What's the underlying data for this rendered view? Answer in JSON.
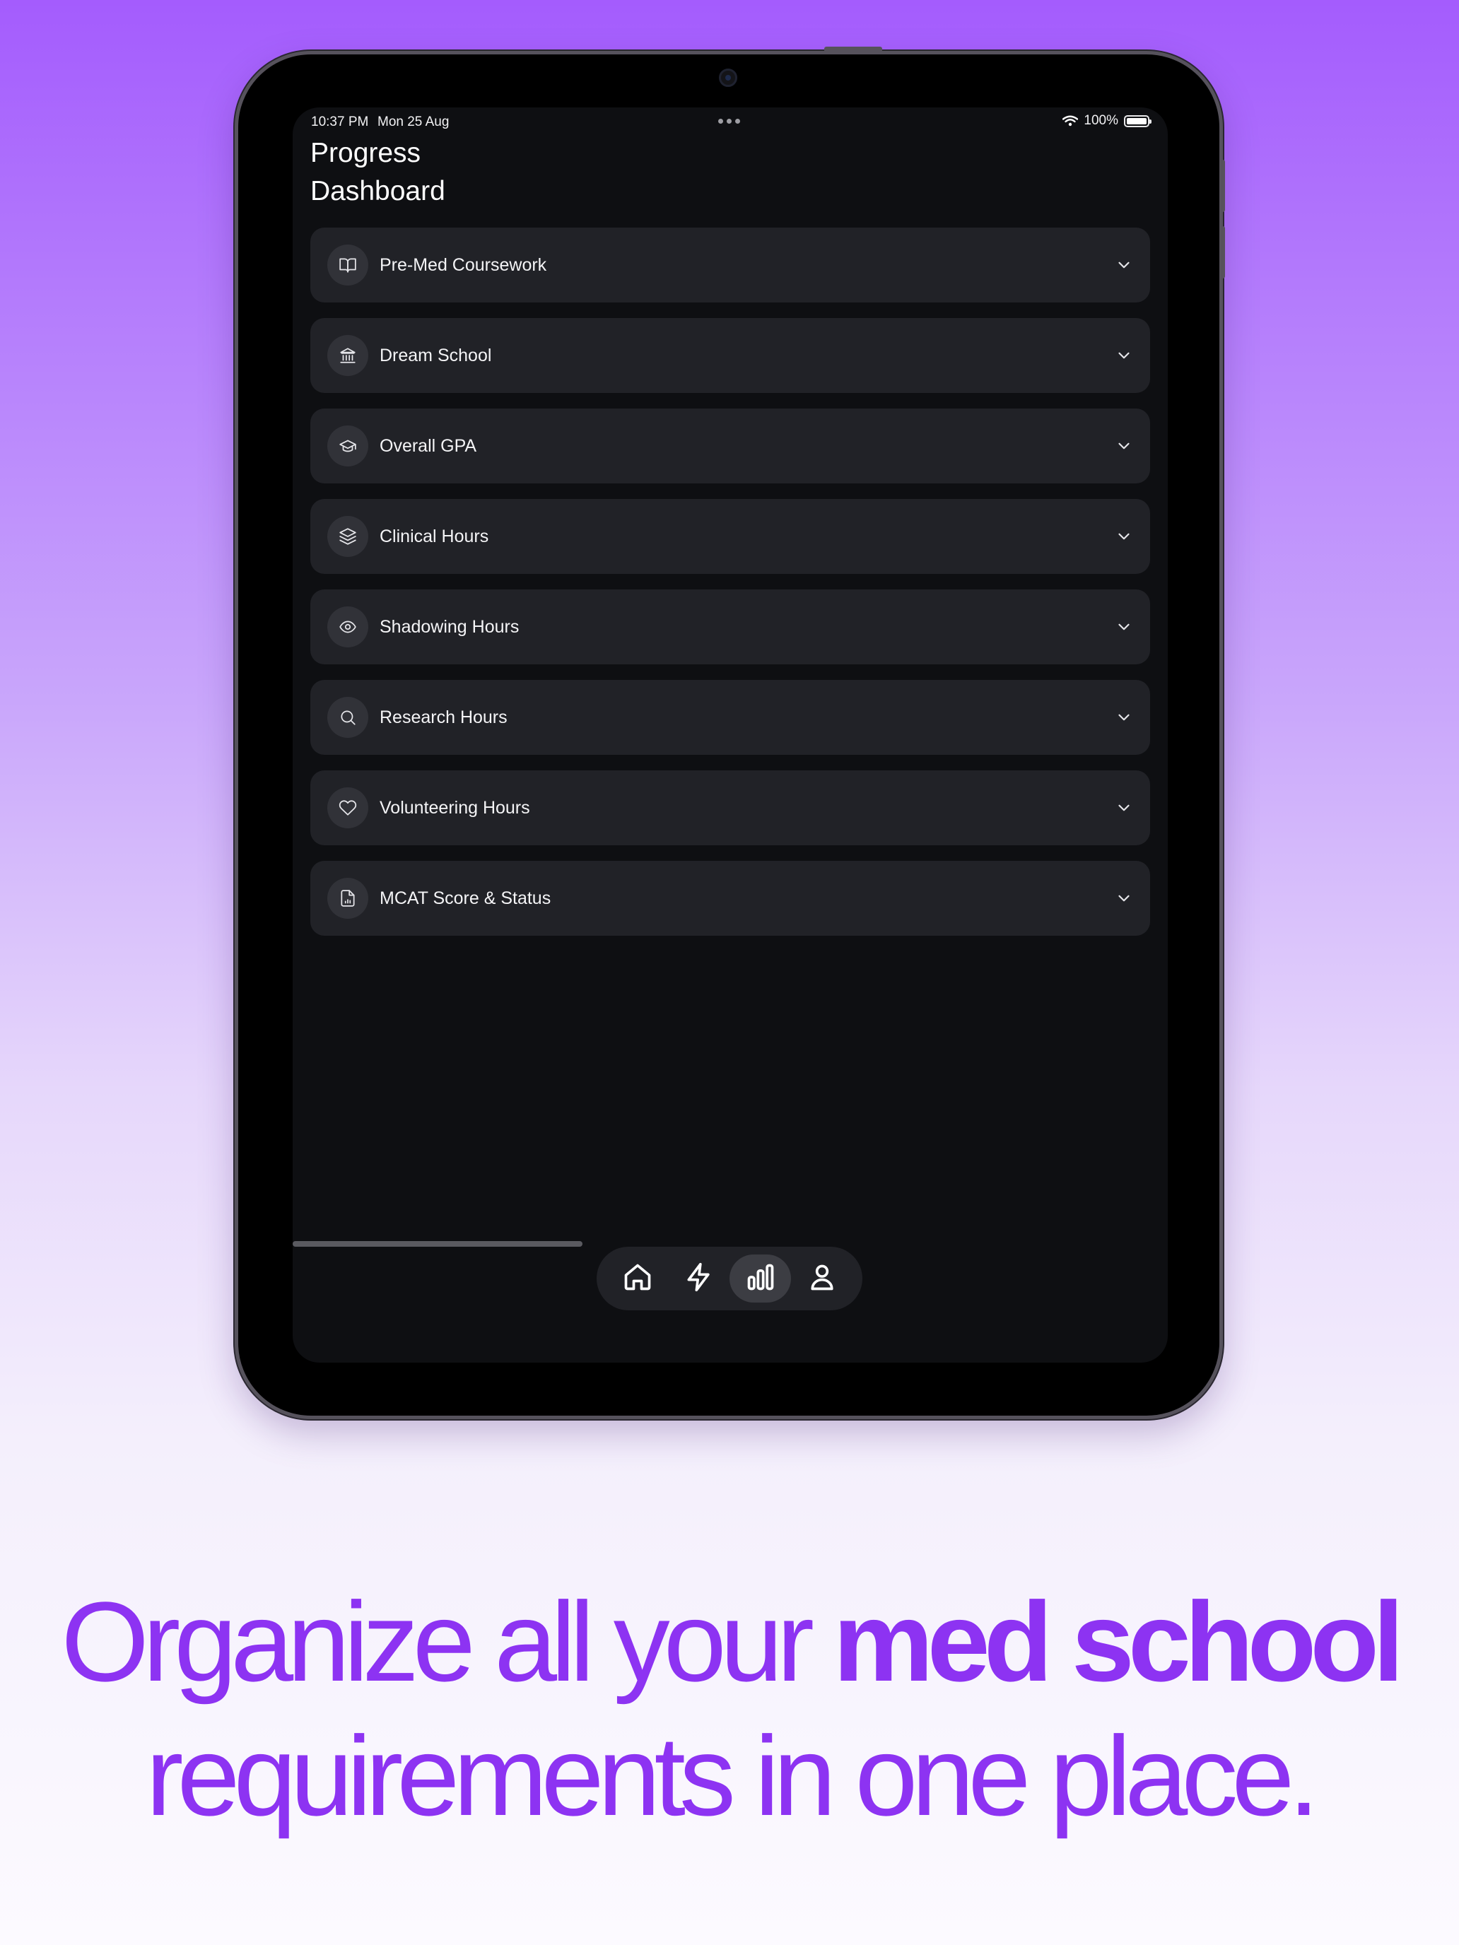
{
  "status_bar": {
    "time": "10:37 PM",
    "date": "Mon 25 Aug",
    "battery": "100%"
  },
  "page": {
    "title_line1": "Progress",
    "title_line2": "Dashboard"
  },
  "sections": [
    {
      "label": "Pre-Med Coursework",
      "icon": "book-icon"
    },
    {
      "label": "Dream School",
      "icon": "building-icon"
    },
    {
      "label": "Overall GPA",
      "icon": "graduation-cap-icon"
    },
    {
      "label": "Clinical Hours",
      "icon": "layers-icon"
    },
    {
      "label": "Shadowing Hours",
      "icon": "eye-icon"
    },
    {
      "label": "Research Hours",
      "icon": "search-icon"
    },
    {
      "label": "Volunteering Hours",
      "icon": "heart-icon"
    },
    {
      "label": "MCAT Score & Status",
      "icon": "file-chart-icon"
    }
  ],
  "tab_bar": {
    "tabs": [
      {
        "name": "home",
        "icon": "home-icon",
        "active": false
      },
      {
        "name": "activity",
        "icon": "lightning-icon",
        "active": false
      },
      {
        "name": "progress",
        "icon": "bar-chart-icon",
        "active": true
      },
      {
        "name": "profile",
        "icon": "person-icon",
        "active": false
      }
    ]
  },
  "headline": {
    "part1": "Organize all your ",
    "part2_bold": "med school",
    "line2": "requirements in one place."
  },
  "colors": {
    "accent": "#8d33f2",
    "screen_bg": "#0e0f12",
    "card_bg": "#212227"
  }
}
